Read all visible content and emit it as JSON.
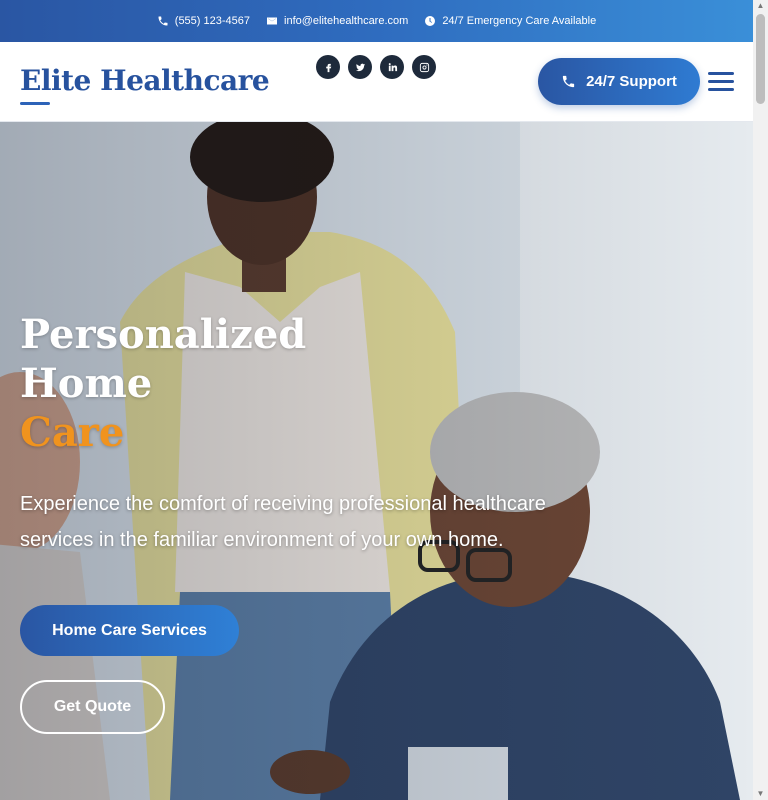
{
  "topbar": {
    "phone": "(555) 123-4567",
    "email": "info@elitehealthcare.com",
    "emergency": "24/7 Emergency Care Available"
  },
  "header": {
    "logo": "Elite Healthcare",
    "support_label": "24/7 Support",
    "socials": [
      "facebook-icon",
      "twitter-icon",
      "linkedin-icon",
      "instagram-icon"
    ]
  },
  "hero": {
    "title_line1": "Personalized",
    "title_line2": "Home",
    "title_accent": "Care",
    "subtitle": "Experience the comfort of receiving professional healthcare services in the familiar environment of your own home.",
    "primary_button": "Home Care Services",
    "secondary_button": "Get Quote"
  },
  "colors": {
    "brand_blue": "#27529e",
    "accent_orange": "#f0931e"
  }
}
